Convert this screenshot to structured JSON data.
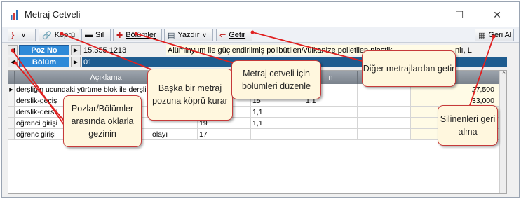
{
  "window": {
    "title": "Metraj Cetveli",
    "maximize_glyph": "☐",
    "close_glyph": "✕"
  },
  "toolbar": {
    "menu_icon": "}",
    "menu_caret": "∨",
    "kopru_label": "Köprü",
    "sil_label": "Sil",
    "bolumler_label": "Bölümler",
    "yazdir_label": "Yazdır",
    "yazdir_caret": "∨",
    "getir_label": "Getir",
    "geri_al_label": "Geri Al"
  },
  "nav": {
    "poz_label": "Poz No",
    "poz_value": "15.355.1213",
    "poz_desc": "Alüminyum ile güçlendirilmiş polibütilen/vulkanize polietilen plastik...",
    "poz_desc_end": "nlı, L",
    "bolum_label": "Bölüm",
    "bolum_value": "01"
  },
  "grid": {
    "headers": [
      "Açıklama",
      "",
      "",
      "n",
      "",
      "",
      ""
    ],
    "rows": [
      {
        "aciklama": "derşliğin ucundaki yürüme blok ile derşlik",
        "c2": "",
        "c3": "",
        "c4": "",
        "c5": "",
        "result": "27,500",
        "selected": true
      },
      {
        "aciklama": "derslik-geçiş",
        "c2": "",
        "c3": "15",
        "c4": "1,1",
        "c5": "",
        "result": "33,000",
        "selected": false
      },
      {
        "aciklama": "derslik-dersli",
        "c2": "",
        "c3": "1,1",
        "c4": "",
        "c5": "",
        "result": "",
        "selected": false
      },
      {
        "aciklama": "öğrenci girişi",
        "c2": "19",
        "c3": "1,1",
        "c4": "",
        "c5": "",
        "result": "",
        "selected": false
      },
      {
        "aciklama": "öğrenc girişi",
        "aciklama_end": "olayı",
        "c2": "17",
        "c3": "",
        "c4": "",
        "c5": "",
        "result": "",
        "selected": false
      }
    ]
  },
  "callouts": {
    "kopru": "Başka bir metraj pozuna köprü kurar",
    "bolumler": "Metraj cetveli için bölümleri düzenle",
    "getir": "Diğer metrajlardan getir",
    "geri_al": "Silinenleri geri alma",
    "nav": "Pozlar/Bölümler arasında oklarla gezinin"
  },
  "colors": {
    "callout_border": "#c63a3a",
    "callout_bg": "#fff7de",
    "arrow": "#e02020",
    "nav_blue": "#2e8ad8",
    "cell_yellow": "#fffbe6"
  }
}
